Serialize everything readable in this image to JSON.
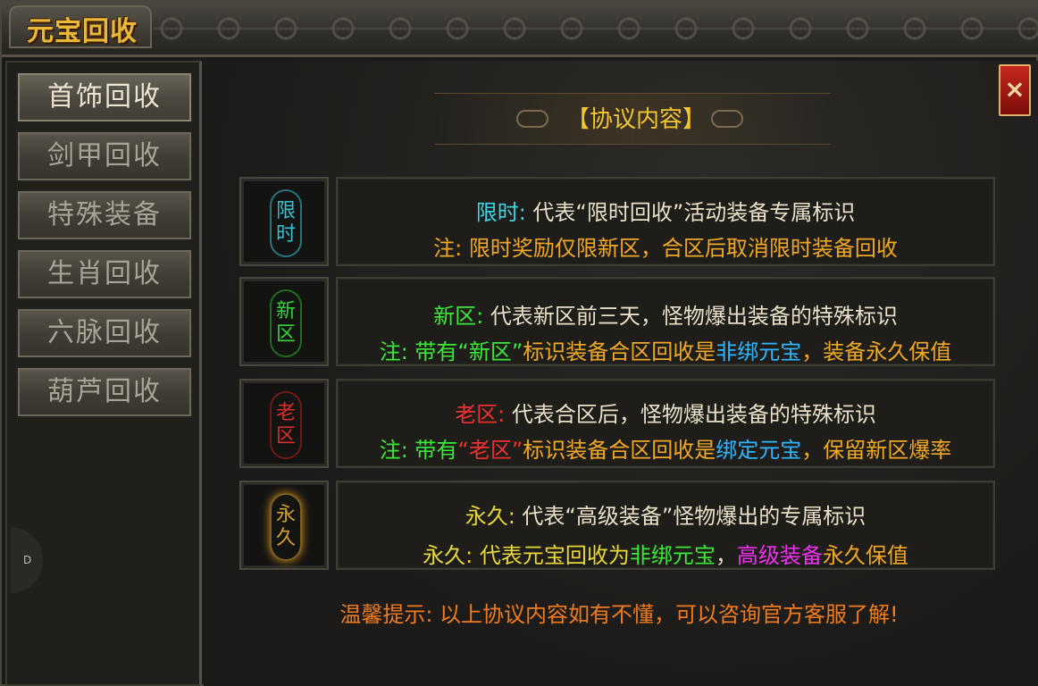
{
  "window": {
    "title": "元宝回收",
    "close_label": "×"
  },
  "sidebar": {
    "items": [
      {
        "label": "首饰回收",
        "active": true
      },
      {
        "label": "剑甲回收",
        "active": false
      },
      {
        "label": "特殊装备",
        "active": false
      },
      {
        "label": "生肖回收",
        "active": false
      },
      {
        "label": "六脉回收",
        "active": false
      },
      {
        "label": "葫芦回收",
        "active": false
      }
    ],
    "handle_label": "D"
  },
  "heading": "【协议内容】",
  "rows": [
    {
      "icon": "limited-rune-icon",
      "icon_chars": [
        "限",
        "时"
      ],
      "icon_color": "#39d6e6",
      "line1": {
        "tag": "限时:",
        "text": " 代表“限时回收”活动装备专属标识"
      },
      "line2": {
        "text": "注: 限时奖励仅限新区，合区后取消限时装备回收"
      }
    },
    {
      "icon": "new-server-rune-icon",
      "icon_chars": [
        "新",
        "区"
      ],
      "icon_color": "#3be83a",
      "line1": {
        "tag": "新区:",
        "text": " 代表新区前三天，怪物爆出装备的特殊标识"
      },
      "line2": {
        "prefix": "注: 带有",
        "quote": "“新区”",
        "mid": "标识装备合区回收是",
        "highlight": "非绑元宝",
        "suffix": "，装备永久保值"
      }
    },
    {
      "icon": "old-server-rune-icon",
      "icon_chars": [
        "老",
        "区"
      ],
      "icon_color": "#f03030",
      "line1": {
        "tag": "老区:",
        "text": " 代表合区后，怪物爆出装备的特殊标识"
      },
      "line2": {
        "prefix": "注: 带有",
        "quote": "“老区”",
        "mid": "标识装备合区回收是",
        "highlight": "绑定元宝",
        "suffix": "，保留新区爆率"
      }
    },
    {
      "icon": "permanent-rune-icon",
      "icon_chars": [
        "永",
        "久"
      ],
      "icon_color": "#e8b030",
      "line1": {
        "tag": "永久:",
        "text": " 代表“高级装备”怪物爆出的专属标识"
      },
      "line2": {
        "prefix": "永久: 代表元宝回收为",
        "highlight": "非绑元宝",
        "mid": "，",
        "highlight2": "高级装备",
        "suffix": "永久保值"
      }
    }
  ],
  "tip": "温馨提示: 以上协议内容如有不懂，可以咨询官方客服了解!"
}
